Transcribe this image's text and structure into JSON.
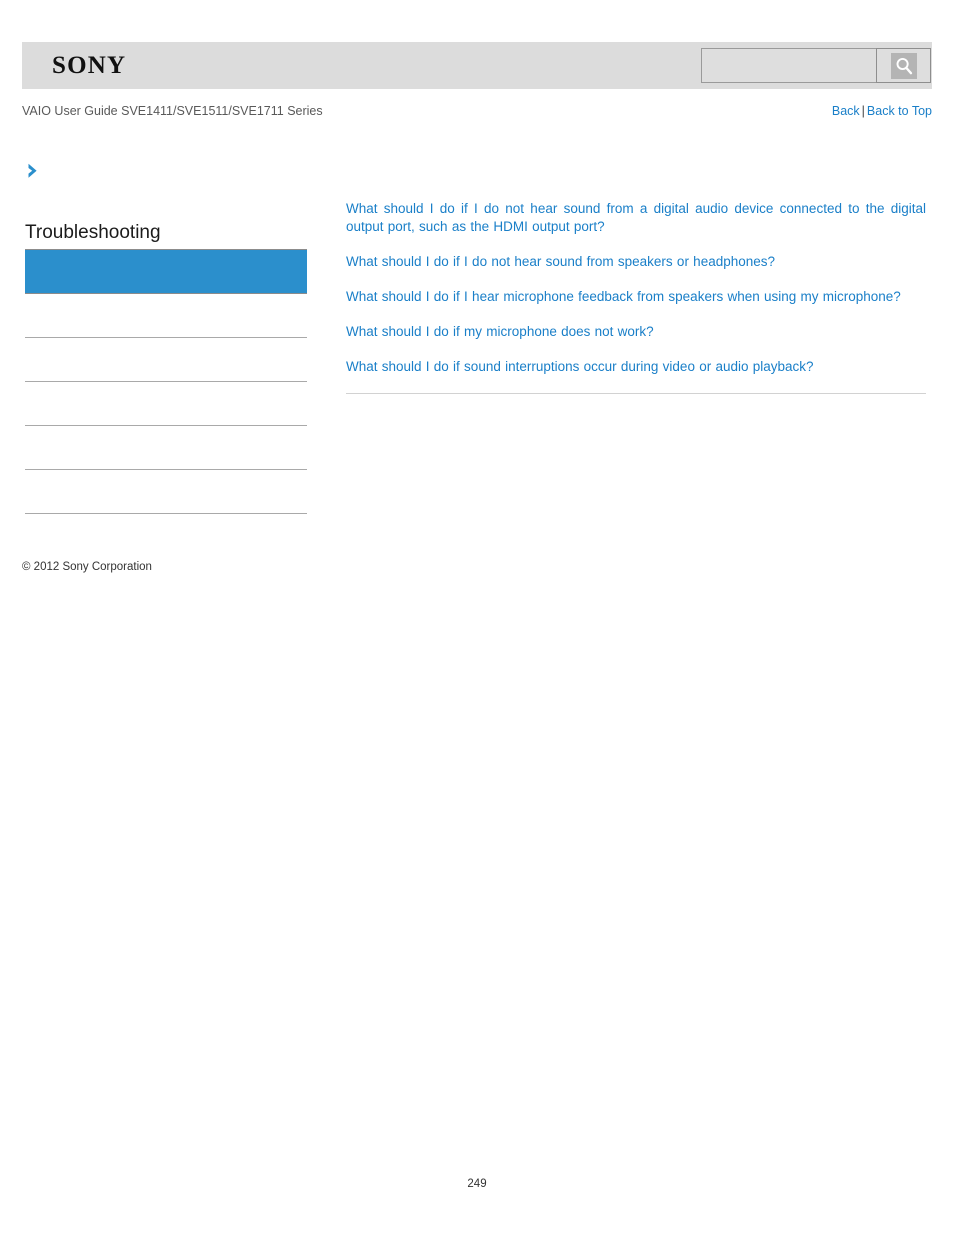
{
  "header": {
    "logo_text": "SONY",
    "search": {
      "value": "",
      "placeholder": "",
      "icon": "search-icon"
    }
  },
  "sub_header": {
    "guide_title": "VAIO User Guide SVE1411/SVE1511/SVE1711 Series",
    "back_label": "Back",
    "separator": "|",
    "back_to_top_label": "Back to Top"
  },
  "sidebar": {
    "chevron_icon": "chevron-right-icon",
    "title": "Troubleshooting",
    "accent_color": "#2b8fcc",
    "items": [
      {
        "label": "",
        "selected": true
      },
      {
        "label": "",
        "selected": false
      },
      {
        "label": "",
        "selected": false
      },
      {
        "label": "",
        "selected": false
      },
      {
        "label": "",
        "selected": false
      },
      {
        "label": "",
        "selected": false
      }
    ]
  },
  "main": {
    "link_color": "#1a7fc8",
    "topics": [
      "What should I do if I do not hear sound from a digital audio device connected to the digital output port, such as the HDMI output port?",
      "What should I do if I do not hear sound from speakers or headphones?",
      "What should I do if I hear microphone feedback from speakers when using my microphone?",
      "What should I do if my microphone does not work?",
      "What should I do if sound interruptions occur during video or audio playback?"
    ]
  },
  "footer": {
    "copyright": "© 2012 Sony Corporation",
    "page_number": "249"
  }
}
